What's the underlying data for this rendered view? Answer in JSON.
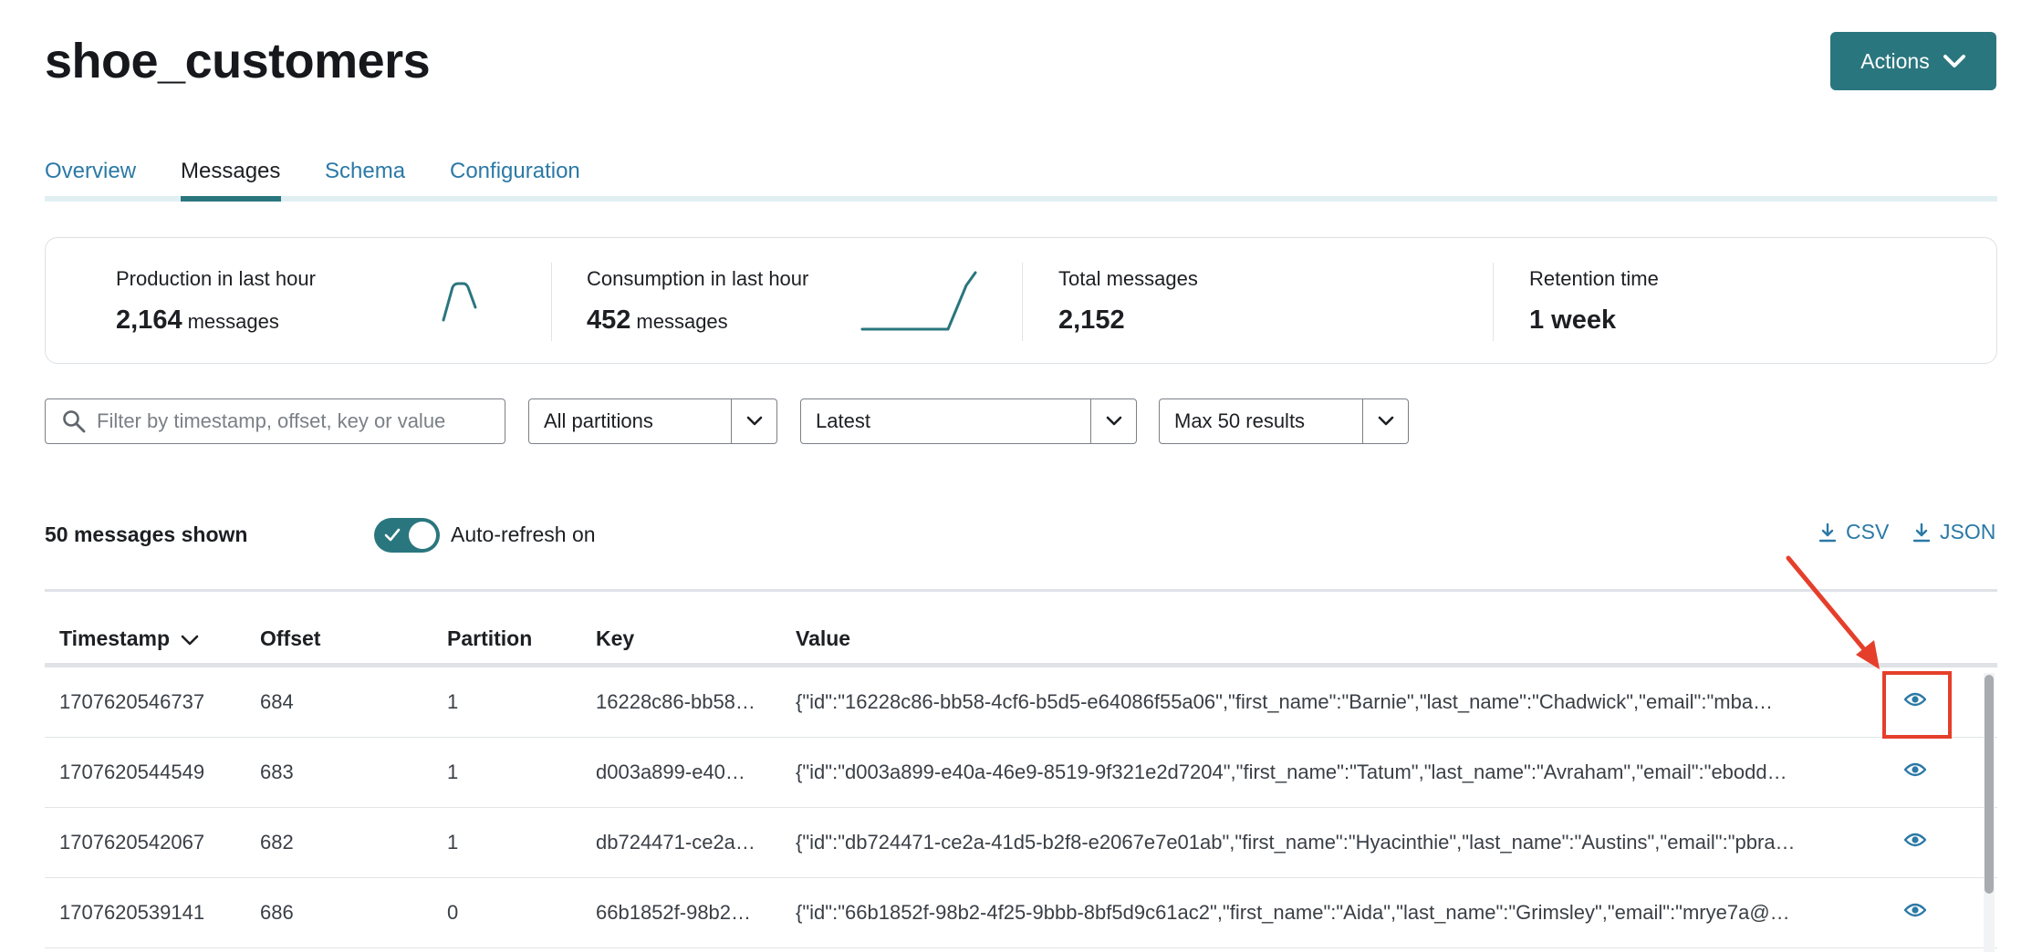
{
  "page": {
    "title": "shoe_customers"
  },
  "header": {
    "actions_label": "Actions",
    "actions_icon": "chevron-down-icon"
  },
  "tabs": [
    {
      "label": "Overview",
      "active": false
    },
    {
      "label": "Messages",
      "active": true
    },
    {
      "label": "Schema",
      "active": false
    },
    {
      "label": "Configuration",
      "active": false
    }
  ],
  "stats": {
    "production": {
      "label": "Production in last hour",
      "value": "2,164",
      "unit": "messages"
    },
    "consumption": {
      "label": "Consumption in last hour",
      "value": "452",
      "unit": "messages"
    },
    "total": {
      "label": "Total messages",
      "value": "2,152"
    },
    "retention": {
      "label": "Retention time",
      "value": "1 week"
    }
  },
  "filters": {
    "search_placeholder": "Filter by timestamp, offset, key or value",
    "search_value": "",
    "partitions": "All partitions",
    "offset": "Latest",
    "limit": "Max 50 results"
  },
  "toolbar": {
    "shown": "50 messages shown",
    "auto_refresh": "Auto-refresh on",
    "auto_refresh_enabled": true,
    "csv": "CSV",
    "json": "JSON"
  },
  "table": {
    "columns": [
      "Timestamp",
      "Offset",
      "Partition",
      "Key",
      "Value"
    ],
    "sorted_by": "Timestamp",
    "rows": [
      {
        "timestamp": "1707620546737",
        "offset": "684",
        "partition": "1",
        "key": "16228c86-bb58…",
        "value": "{\"id\":\"16228c86-bb58-4cf6-b5d5-e64086f55a06\",\"first_name\":\"Barnie\",\"last_name\":\"Chadwick\",\"email\":\"mba…"
      },
      {
        "timestamp": "1707620544549",
        "offset": "683",
        "partition": "1",
        "key": "d003a899-e40…",
        "value": "{\"id\":\"d003a899-e40a-46e9-8519-9f321e2d7204\",\"first_name\":\"Tatum\",\"last_name\":\"Avraham\",\"email\":\"ebodd…"
      },
      {
        "timestamp": "1707620542067",
        "offset": "682",
        "partition": "1",
        "key": "db724471-ce2a…",
        "value": "{\"id\":\"db724471-ce2a-41d5-b2f8-e2067e7e01ab\",\"first_name\":\"Hyacinthie\",\"last_name\":\"Austins\",\"email\":\"pbra…"
      },
      {
        "timestamp": "1707620539141",
        "offset": "686",
        "partition": "0",
        "key": "66b1852f-98b2…",
        "value": "{\"id\":\"66b1852f-98b2-4f25-9bbb-8bf5d9c61ac2\",\"first_name\":\"Aida\",\"last_name\":\"Grimsley\",\"email\":\"mrye7a@…"
      }
    ],
    "row_action_icon": "eye-icon"
  },
  "colors": {
    "accent": "#2a767e",
    "link": "#2b79a6",
    "annotation": "#e53f2b"
  }
}
